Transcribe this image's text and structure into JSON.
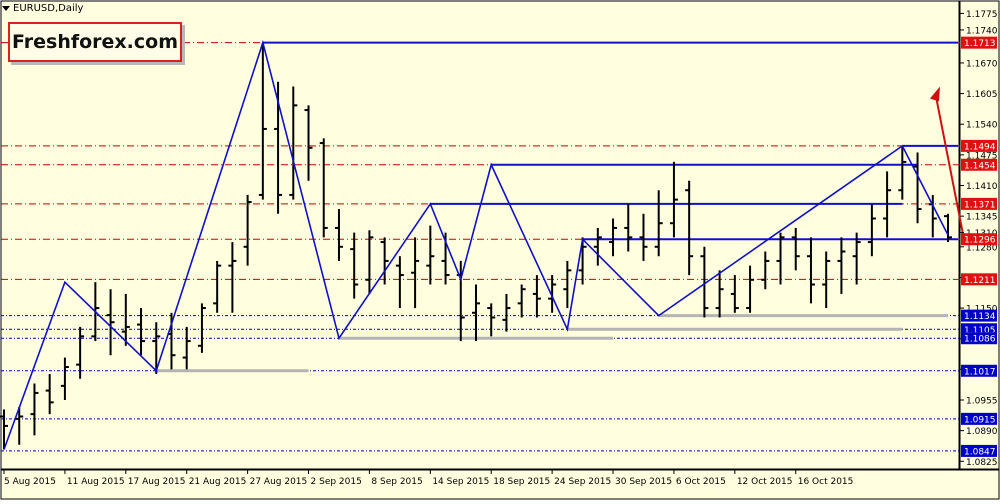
{
  "window": {
    "symbol_label": "EURUSD,Daily"
  },
  "logo": {
    "text": "Freshforex.com"
  },
  "colors": {
    "background": "#ffffe0",
    "bars": "#000000",
    "zigzag": "#1010c8",
    "resistance_line": "#1010c8",
    "support_line": "#b4b4b4",
    "level_dashed_red": "#c80000",
    "level_dashed_blue": "#0000b4",
    "price_tag_red": "#e01010",
    "price_tag_blue": "#0000c8",
    "forecast_arrow": "#d01010"
  },
  "chart_data": {
    "type": "ohlc",
    "price_axis": {
      "ticks": [
        "1.1775",
        "1.1740",
        "1.1670",
        "1.1605",
        "1.1540",
        "1.1475",
        "1.1410",
        "1.1345",
        "1.1310",
        "1.1280",
        "1.1215",
        "1.1150",
        "1.1085",
        "1.1020",
        "1.0955",
        "1.0890",
        "1.0825"
      ],
      "range": [
        1.0815,
        1.1795
      ]
    },
    "time_axis": {
      "ticks": [
        "5 Aug 2015",
        "11 Aug 2015",
        "17 Aug 2015",
        "21 Aug 2015",
        "27 Aug 2015",
        "2 Sep 2015",
        "8 Sep 2015",
        "14 Sep 2015",
        "18 Sep 2015",
        "24 Sep 2015",
        "30 Sep 2015",
        "6 Oct 2015",
        "12 Oct 2015",
        "16 Oct 2015"
      ]
    },
    "bars": [
      {
        "date": "5 Aug 2015",
        "o": 1.092,
        "h": 1.0935,
        "l": 1.085,
        "c": 1.09
      },
      {
        "date": "6 Aug 2015",
        "o": 1.0915,
        "h": 1.094,
        "l": 1.086,
        "c": 1.092
      },
      {
        "date": "7 Aug 2015",
        "o": 1.0925,
        "h": 1.099,
        "l": 1.088,
        "c": 1.097
      },
      {
        "date": "10 Aug 2015",
        "o": 1.0975,
        "h": 1.101,
        "l": 1.0925,
        "c": 1.095
      },
      {
        "date": "11 Aug 2015",
        "o": 1.0985,
        "h": 1.1045,
        "l": 1.0955,
        "c": 1.1025
      },
      {
        "date": "12 Aug 2015",
        "o": 1.103,
        "h": 1.111,
        "l": 1.1,
        "c": 1.109
      },
      {
        "date": "13 Aug 2015",
        "o": 1.109,
        "h": 1.1205,
        "l": 1.108,
        "c": 1.115
      },
      {
        "date": "14 Aug 2015",
        "o": 1.1135,
        "h": 1.119,
        "l": 1.105,
        "c": 1.112
      },
      {
        "date": "17 Aug 2015",
        "o": 1.11,
        "h": 1.118,
        "l": 1.107,
        "c": 1.111
      },
      {
        "date": "18 Aug 2015",
        "o": 1.1115,
        "h": 1.115,
        "l": 1.105,
        "c": 1.108
      },
      {
        "date": "19 Aug 2015",
        "o": 1.108,
        "h": 1.112,
        "l": 1.101,
        "c": 1.109
      },
      {
        "date": "20 Aug 2015",
        "o": 1.1095,
        "h": 1.114,
        "l": 1.102,
        "c": 1.105
      },
      {
        "date": "21 Aug 2015",
        "o": 1.1045,
        "h": 1.111,
        "l": 1.102,
        "c": 1.108
      },
      {
        "date": "24 Aug 2015",
        "o": 1.107,
        "h": 1.116,
        "l": 1.1055,
        "c": 1.115
      },
      {
        "date": "25 Aug 2015",
        "o": 1.116,
        "h": 1.125,
        "l": 1.114,
        "c": 1.124
      },
      {
        "date": "26 Aug 2015",
        "o": 1.124,
        "h": 1.129,
        "l": 1.114,
        "c": 1.125
      },
      {
        "date": "27 Aug 2015",
        "o": 1.128,
        "h": 1.139,
        "l": 1.124,
        "c": 1.1375
      },
      {
        "date": "28 Aug 2015",
        "o": 1.139,
        "h": 1.1713,
        "l": 1.138,
        "c": 1.153
      },
      {
        "date": "31 Aug 2015",
        "o": 1.153,
        "h": 1.163,
        "l": 1.135,
        "c": 1.139
      },
      {
        "date": "1 Sep 2015",
        "o": 1.139,
        "h": 1.162,
        "l": 1.138,
        "c": 1.158
      },
      {
        "date": "2 Sep 2015",
        "o": 1.157,
        "h": 1.158,
        "l": 1.142,
        "c": 1.149
      },
      {
        "date": "3 Sep 2015",
        "o": 1.15,
        "h": 1.151,
        "l": 1.13,
        "c": 1.132
      },
      {
        "date": "4 Sep 2015",
        "o": 1.132,
        "h": 1.136,
        "l": 1.125,
        "c": 1.128
      },
      {
        "date": "7 Sep 2015",
        "o": 1.1275,
        "h": 1.131,
        "l": 1.117,
        "c": 1.12
      },
      {
        "date": "8 Sep 2015",
        "o": 1.121,
        "h": 1.1315,
        "l": 1.118,
        "c": 1.13
      },
      {
        "date": "9 Sep 2015",
        "o": 1.129,
        "h": 1.13,
        "l": 1.12,
        "c": 1.125
      },
      {
        "date": "10 Sep 2015",
        "o": 1.124,
        "h": 1.126,
        "l": 1.115,
        "c": 1.122
      },
      {
        "date": "11 Sep 2015",
        "o": 1.1225,
        "h": 1.13,
        "l": 1.115,
        "c": 1.125
      },
      {
        "date": "14 Sep 2015",
        "o": 1.124,
        "h": 1.1325,
        "l": 1.12,
        "c": 1.126
      },
      {
        "date": "15 Sep 2015",
        "o": 1.125,
        "h": 1.131,
        "l": 1.12,
        "c": 1.122
      },
      {
        "date": "16 Sep 2015",
        "o": 1.122,
        "h": 1.125,
        "l": 1.108,
        "c": 1.113
      },
      {
        "date": "17 Sep 2015",
        "o": 1.114,
        "h": 1.12,
        "l": 1.108,
        "c": 1.116
      },
      {
        "date": "18 Sep 2015",
        "o": 1.115,
        "h": 1.116,
        "l": 1.109,
        "c": 1.113
      },
      {
        "date": "21 Sep 2015",
        "o": 1.1125,
        "h": 1.118,
        "l": 1.11,
        "c": 1.115
      },
      {
        "date": "22 Sep 2015",
        "o": 1.116,
        "h": 1.12,
        "l": 1.113,
        "c": 1.119
      },
      {
        "date": "23 Sep 2015",
        "o": 1.118,
        "h": 1.122,
        "l": 1.113,
        "c": 1.117
      },
      {
        "date": "24 Sep 2015",
        "o": 1.117,
        "h": 1.122,
        "l": 1.114,
        "c": 1.12
      },
      {
        "date": "25 Sep 2015",
        "o": 1.119,
        "h": 1.125,
        "l": 1.115,
        "c": 1.123
      },
      {
        "date": "28 Sep 2015",
        "o": 1.123,
        "h": 1.13,
        "l": 1.12,
        "c": 1.128
      },
      {
        "date": "29 Sep 2015",
        "o": 1.128,
        "h": 1.132,
        "l": 1.124,
        "c": 1.13
      },
      {
        "date": "30 Sep 2015",
        "o": 1.129,
        "h": 1.134,
        "l": 1.126,
        "c": 1.132
      },
      {
        "date": "1 Oct 2015",
        "o": 1.132,
        "h": 1.137,
        "l": 1.127,
        "c": 1.13
      },
      {
        "date": "2 Oct 2015",
        "o": 1.13,
        "h": 1.135,
        "l": 1.125,
        "c": 1.128
      },
      {
        "date": "5 Oct 2015",
        "o": 1.128,
        "h": 1.14,
        "l": 1.126,
        "c": 1.133
      },
      {
        "date": "6 Oct 2015",
        "o": 1.133,
        "h": 1.146,
        "l": 1.13,
        "c": 1.138
      },
      {
        "date": "7 Oct 2015",
        "o": 1.14,
        "h": 1.142,
        "l": 1.122,
        "c": 1.126
      },
      {
        "date": "8 Oct 2015",
        "o": 1.126,
        "h": 1.128,
        "l": 1.113,
        "c": 1.115
      },
      {
        "date": "9 Oct 2015",
        "o": 1.115,
        "h": 1.123,
        "l": 1.113,
        "c": 1.119
      },
      {
        "date": "12 Oct 2015",
        "o": 1.118,
        "h": 1.122,
        "l": 1.114,
        "c": 1.115
      },
      {
        "date": "13 Oct 2015",
        "o": 1.115,
        "h": 1.124,
        "l": 1.114,
        "c": 1.121
      },
      {
        "date": "14 Oct 2015",
        "o": 1.121,
        "h": 1.127,
        "l": 1.119,
        "c": 1.125
      },
      {
        "date": "15 Oct 2015",
        "o": 1.125,
        "h": 1.131,
        "l": 1.12,
        "c": 1.13
      },
      {
        "date": "16 Oct 2015",
        "o": 1.13,
        "h": 1.132,
        "l": 1.123,
        "c": 1.126
      },
      {
        "date": "19 Oct 2015",
        "o": 1.126,
        "h": 1.13,
        "l": 1.116,
        "c": 1.12
      },
      {
        "date": "20 Oct 2015",
        "o": 1.12,
        "h": 1.127,
        "l": 1.115,
        "c": 1.125
      },
      {
        "date": "21 Oct 2015",
        "o": 1.125,
        "h": 1.13,
        "l": 1.118,
        "c": 1.127
      },
      {
        "date": "22 Oct 2015",
        "o": 1.126,
        "h": 1.131,
        "l": 1.12,
        "c": 1.129
      },
      {
        "date": "23 Oct 2015",
        "o": 1.129,
        "h": 1.137,
        "l": 1.126,
        "c": 1.134
      },
      {
        "date": "26 Oct 2015",
        "o": 1.134,
        "h": 1.144,
        "l": 1.13,
        "c": 1.14
      },
      {
        "date": "27 Oct 2015",
        "o": 1.14,
        "h": 1.1494,
        "l": 1.138,
        "c": 1.146
      },
      {
        "date": "28 Oct 2015",
        "o": 1.145,
        "h": 1.148,
        "l": 1.133,
        "c": 1.136
      },
      {
        "date": "29 Oct 2015",
        "o": 1.137,
        "h": 1.139,
        "l": 1.13,
        "c": 1.134
      },
      {
        "date": "30 Oct 2015",
        "o": 1.1345,
        "h": 1.135,
        "l": 1.129,
        "c": 1.13
      }
    ],
    "zigzag": [
      {
        "date": "5 Aug 2015",
        "price": 1.085
      },
      {
        "date": "11 Aug 2015",
        "price": 1.1205
      },
      {
        "date": "19 Aug 2015",
        "price": 1.1017
      },
      {
        "date": "28 Aug 2015",
        "price": 1.1713
      },
      {
        "date": "4 Sep 2015",
        "price": 1.1086
      },
      {
        "date": "14 Sep 2015",
        "price": 1.1371
      },
      {
        "date": "16 Sep 2015",
        "price": 1.1211
      },
      {
        "date": "18 Sep 2015",
        "price": 1.1454
      },
      {
        "date": "25 Sep 2015",
        "price": 1.1105
      },
      {
        "date": "28 Sep 2015",
        "price": 1.1296
      },
      {
        "date": "5 Oct 2015",
        "price": 1.1134
      },
      {
        "date": "27 Oct 2015",
        "price": 1.1494
      },
      {
        "date": "30 Oct 2015",
        "price": 1.1305
      }
    ],
    "price_levels": [
      {
        "label": "1.1713",
        "price": 1.1713,
        "color": "red"
      },
      {
        "label": "1.1494",
        "price": 1.1494,
        "color": "red"
      },
      {
        "label": "1.1454",
        "price": 1.1454,
        "color": "red"
      },
      {
        "label": "1.1371",
        "price": 1.1371,
        "color": "red"
      },
      {
        "label": "1.1296",
        "price": 1.1296,
        "color": "red"
      },
      {
        "label": "1.1211",
        "price": 1.1211,
        "color": "red"
      },
      {
        "label": "1.1134",
        "price": 1.1134,
        "color": "blue"
      },
      {
        "label": "1.1105",
        "price": 1.1105,
        "color": "blue"
      },
      {
        "label": "1.1086",
        "price": 1.1086,
        "color": "blue"
      },
      {
        "label": "1.1017",
        "price": 1.1017,
        "color": "blue"
      },
      {
        "label": "1.0915",
        "price": 1.0915,
        "color": "blue"
      },
      {
        "label": "1.0847",
        "price": 1.0847,
        "color": "blue"
      }
    ],
    "resistance_lines": [
      {
        "from": "28 Aug 2015",
        "to": "30 Oct 2015",
        "price": 1.1713
      },
      {
        "from": "27 Oct 2015",
        "to": "30 Oct 2015",
        "price": 1.1494
      },
      {
        "from": "18 Sep 2015",
        "to": "28 Oct 2015",
        "price": 1.1454
      },
      {
        "from": "14 Sep 2015",
        "to": "27 Oct 2015",
        "price": 1.1371
      },
      {
        "from": "28 Sep 2015",
        "to": "30 Oct 2015",
        "price": 1.1296
      }
    ],
    "support_lines": [
      {
        "from": "19 Aug 2015",
        "to": "2 Sep 2015",
        "price": 1.1017
      },
      {
        "from": "4 Sep 2015",
        "to": "30 Sep 2015",
        "price": 1.1086
      },
      {
        "from": "25 Sep 2015",
        "to": "27 Oct 2015",
        "price": 1.1105
      },
      {
        "from": "5 Oct 2015",
        "to": "30 Oct 2015",
        "price": 1.1134
      }
    ],
    "forecast_arrow": {
      "from_price": 1.1296,
      "to_price": 1.162
    },
    "grid": false,
    "legend": "none"
  }
}
